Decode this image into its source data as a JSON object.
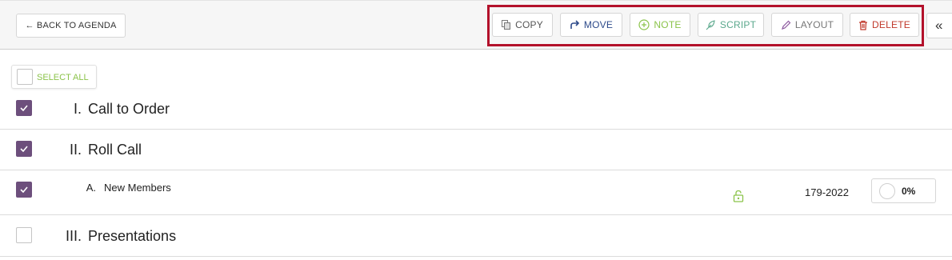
{
  "toolbar": {
    "back_label": "← BACK TO AGENDA",
    "copy_label": "COPY",
    "move_label": "MOVE",
    "note_label": "NOTE",
    "script_label": "SCRIPT",
    "layout_label": "LAYOUT",
    "delete_label": "DELETE",
    "collapse_label": "«"
  },
  "select_all": {
    "label": "SELECT ALL",
    "checked": false
  },
  "agenda": {
    "items": [
      {
        "number": "I.",
        "title": "Call to Order",
        "checked": true
      },
      {
        "number": "II.",
        "title": "Roll Call",
        "checked": true
      },
      {
        "number": "A.",
        "title": "New Members",
        "checked": true,
        "doc_number": "179-2022",
        "progress": "0%",
        "locked": true
      },
      {
        "number": "III.",
        "title": "Presentations",
        "checked": false
      }
    ]
  },
  "colors": {
    "highlight_border": "#b3112b",
    "checkbox_checked": "#6d4f7c",
    "note_green": "#8bc34a",
    "delete_red": "#c0392b",
    "move_blue": "#2d4a8a"
  }
}
